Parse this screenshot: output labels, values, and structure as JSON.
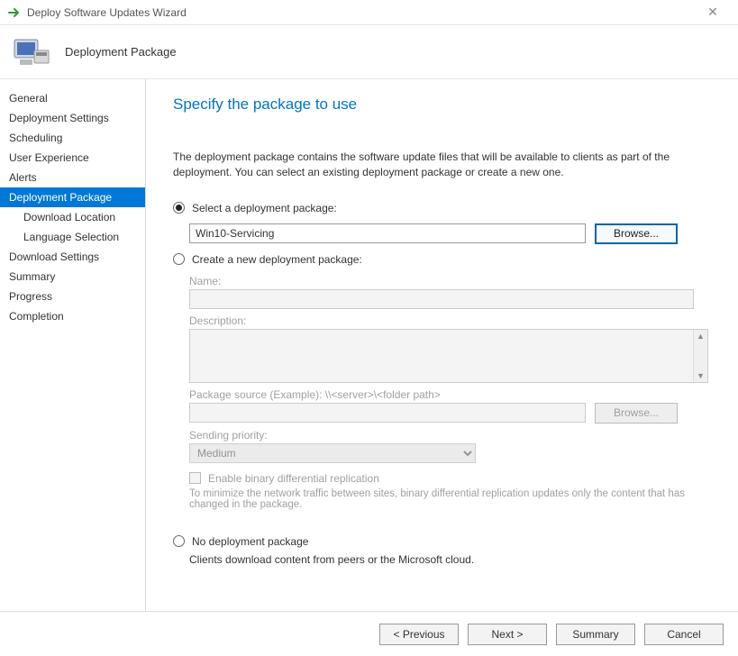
{
  "window": {
    "title": "Deploy Software Updates Wizard"
  },
  "header": {
    "page_title": "Deployment Package"
  },
  "sidebar": {
    "items": [
      {
        "label": "General",
        "sub": false,
        "selected": false
      },
      {
        "label": "Deployment Settings",
        "sub": false,
        "selected": false
      },
      {
        "label": "Scheduling",
        "sub": false,
        "selected": false
      },
      {
        "label": "User Experience",
        "sub": false,
        "selected": false
      },
      {
        "label": "Alerts",
        "sub": false,
        "selected": false
      },
      {
        "label": "Deployment Package",
        "sub": false,
        "selected": true
      },
      {
        "label": "Download Location",
        "sub": true,
        "selected": false
      },
      {
        "label": "Language Selection",
        "sub": true,
        "selected": false
      },
      {
        "label": "Download Settings",
        "sub": false,
        "selected": false
      },
      {
        "label": "Summary",
        "sub": false,
        "selected": false
      },
      {
        "label": "Progress",
        "sub": false,
        "selected": false
      },
      {
        "label": "Completion",
        "sub": false,
        "selected": false
      }
    ]
  },
  "main": {
    "heading": "Specify the package to use",
    "intro": "The deployment package contains the software update files that will be available to clients as part of the deployment. You can select an existing deployment package or create a new one.",
    "option_select": {
      "label": "Select a deployment package:",
      "value": "Win10-Servicing",
      "browse": "Browse..."
    },
    "option_create": {
      "label": "Create a new deployment package:",
      "name_label": "Name:",
      "name_value": "",
      "desc_label": "Description:",
      "desc_value": "",
      "source_label": "Package source (Example): \\\\<server>\\<folder path>",
      "source_value": "",
      "browse": "Browse...",
      "priority_label": "Sending priority:",
      "priority_value": "Medium",
      "binary_label": "Enable binary differential replication",
      "binary_hint": "To minimize the network traffic between sites, binary differential replication updates only the content that has changed in the package."
    },
    "option_none": {
      "label": "No deployment package",
      "note": "Clients download content from peers or the Microsoft cloud."
    }
  },
  "footer": {
    "previous": "< Previous",
    "next": "Next >",
    "summary": "Summary",
    "cancel": "Cancel"
  }
}
